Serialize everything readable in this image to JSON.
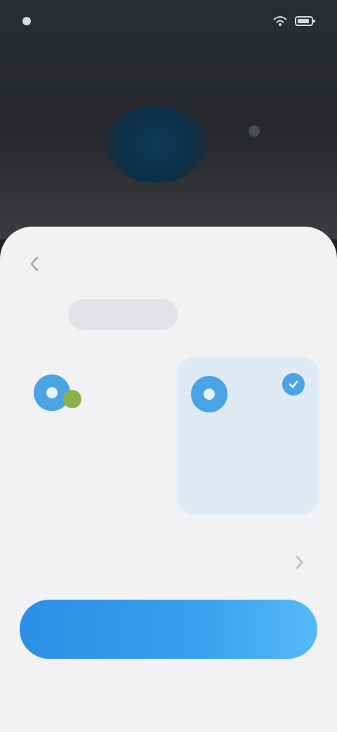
{
  "status_bar": {
    "time": "",
    "network": ""
  },
  "sheet": {
    "title": "",
    "back_icon": "chevron-left-icon",
    "tabs": [
      {
        "label": "",
        "active": true
      },
      {
        "label": "",
        "active": false
      }
    ],
    "cards": [
      {
        "title": "",
        "description": "",
        "icon": "app-icon",
        "selected": false
      },
      {
        "title": "",
        "description": "",
        "icon": "app-icon",
        "selected": true
      }
    ],
    "settings_row": {
      "label": "",
      "sublabel": ""
    },
    "primary_button": {
      "label": ""
    },
    "footer": {
      "text": ""
    }
  },
  "colors": {
    "accent": "#2c8fe6",
    "selected_card_bg": "#dfe9f4",
    "sheet_bg": "#f2f2f4",
    "top_bg": "#26282b"
  }
}
